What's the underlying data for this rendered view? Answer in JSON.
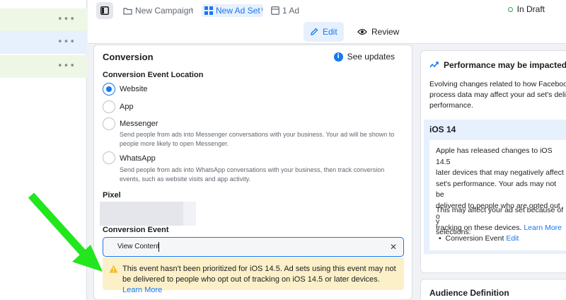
{
  "breadcrumb": {
    "campaign": "New Campaign",
    "adset": "New Ad Set",
    "ad": "1 Ad"
  },
  "status": "In Draft",
  "modes": {
    "edit": "Edit",
    "review": "Review"
  },
  "conversion": {
    "title": "Conversion",
    "see_updates": "See updates",
    "location_label": "Conversion Event Location",
    "options": [
      {
        "label": "Website",
        "selected": true,
        "desc": ""
      },
      {
        "label": "App",
        "selected": false,
        "desc": ""
      },
      {
        "label": "Messenger",
        "selected": false,
        "desc_line1": "Send people from ads into Messenger conversations with your business. Your ad will be shown to",
        "desc_line2": "people more likely to open Messenger."
      },
      {
        "label": "WhatsApp",
        "selected": false,
        "desc_line1": "Send people from ads into WhatsApp conversations with your business, then track conversion",
        "desc_line2": "events, such as website visits and app activity."
      }
    ],
    "pixel_label": "Pixel",
    "event_label": "Conversion Event",
    "event_value": "View Content",
    "warning_text": "This event hasn't been prioritized for iOS 14.5. Ad sets using this event may not be delivered to people who opt out of tracking on iOS 14.5 or later devices.",
    "warning_link": "Learn More"
  },
  "performance": {
    "title": "Performance may be impacted",
    "line1": "Evolving changes related to how Faceboo",
    "line2": "process data may affect your ad set's deli",
    "line3": "performance.",
    "ios_title": "iOS 14",
    "ios_l1": "Apple has released changes to iOS 14.5",
    "ios_l2": "later devices that may negatively affect",
    "ios_l3": "set's performance. Your ads may not be",
    "ios_l4": "delivered to people who are opted out o",
    "ios_l5": "tracking on these devices.",
    "ios_link": "Learn More",
    "affect_l1": "This may affect your ad set because of y",
    "affect_l2": "selections:",
    "bullet": "Conversion Event",
    "bullet_link": "Edit"
  },
  "audience": {
    "title": "Audience Definition"
  },
  "colors": {
    "accent": "#1877f2",
    "warning_bg": "#fcf0c9",
    "arrow": "#22e61e",
    "draft": "#31a24c"
  }
}
